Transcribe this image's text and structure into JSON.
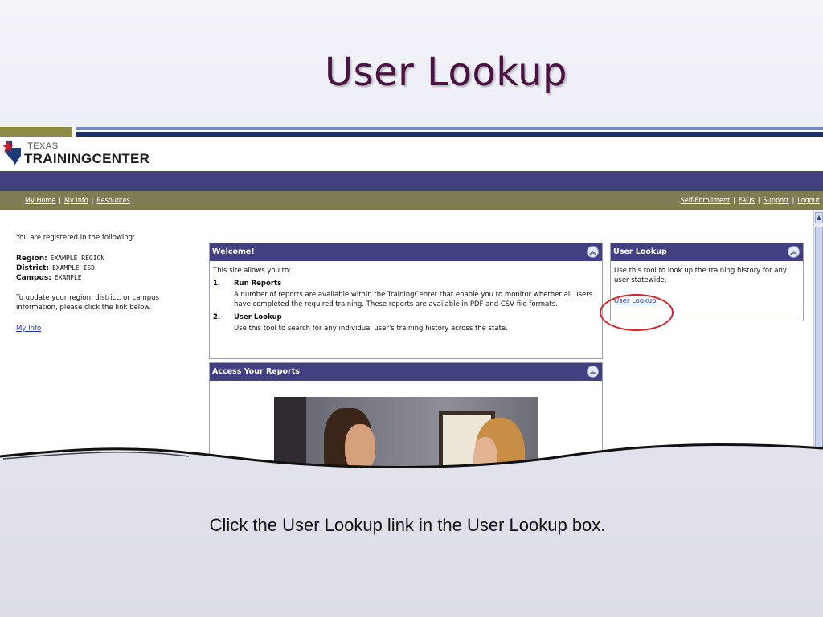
{
  "slide": {
    "title": "User Lookup",
    "caption": "Click the User Lookup link in the User Lookup box."
  },
  "logo": {
    "texas": "TEXAS",
    "name": "TRAININGCENTER"
  },
  "nav": {
    "left": [
      "My Home",
      "My Info",
      "Resources"
    ],
    "right": [
      "Self-Enrollment",
      "FAQs",
      "Support",
      "Logout"
    ]
  },
  "sidebar": {
    "intro": "You are registered in the following:",
    "region_label": "Region:",
    "region_value": "EXAMPLE REGION",
    "district_label": "District:",
    "district_value": "EXAMPLE ISD",
    "campus_label": "Campus:",
    "campus_value": "EXAMPLE",
    "update_text": "To update your region, district, or campus information, please click the link below.",
    "my_info_link": "My Info"
  },
  "welcome": {
    "title": "Welcome!",
    "intro": "This site allows you to:",
    "items": [
      {
        "num": "1.",
        "title": "Run Reports",
        "desc": "A number of reports are available within the TrainingCenter that enable you to monitor whether all users have completed the required training. These reports are available in PDF and CSV file formats."
      },
      {
        "num": "2.",
        "title": "User Lookup",
        "desc": "Use this tool to search for any individual user's training history across the state."
      }
    ]
  },
  "lookup_box": {
    "title": "User Lookup",
    "desc": "Use this tool to look up the training history for any user statewide.",
    "link": "User Lookup"
  },
  "reports": {
    "title": "Access Your Reports"
  },
  "icons": {
    "collapse": "double-chevron-up-icon",
    "scroll_up": "arrow-up-icon"
  },
  "colors": {
    "title": "#4a1242",
    "header_band": "#434082",
    "nav_band": "#7f7c55",
    "highlight_circle": "#d8202a",
    "link": "#2233aa"
  }
}
